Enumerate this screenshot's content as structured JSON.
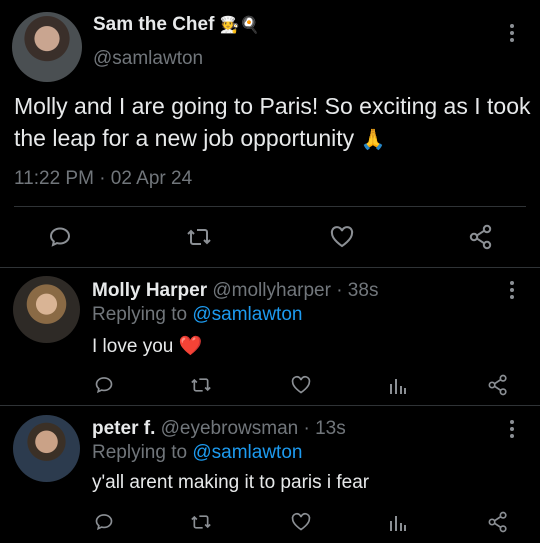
{
  "main_tweet": {
    "display_name": "Sam the Chef",
    "name_emoji": "🧑‍🍳🍳",
    "handle": "@samlawton",
    "text": "Molly and I are going to Paris! So exciting as I took the leap for a new job opportunity",
    "text_emoji": "🙏",
    "timestamp": "11:22 PM · 02 Apr 24"
  },
  "replies": [
    {
      "display_name": "Molly Harper",
      "handle_time": "@mollyharper · 38s",
      "replying_prefix": "Replying to ",
      "replying_handle": "@samlawton",
      "text": "I love you",
      "text_emoji": "❤️"
    },
    {
      "display_name": "peter f.",
      "handle_time": "@eyebrowsman · 13s",
      "replying_prefix": "Replying to ",
      "replying_handle": "@samlawton",
      "text": "y'all arent making it to paris i fear",
      "text_emoji": ""
    }
  ],
  "icons": {
    "reply": "reply-icon",
    "retweet": "retweet-icon",
    "like": "heart-icon",
    "analytics": "analytics-icon",
    "share": "share-icon",
    "more": "more-icon"
  },
  "colors": {
    "background": "#000000",
    "text": "#e7e9ea",
    "muted": "#71767b",
    "link": "#1d9bf0",
    "heart": "#f4212e"
  }
}
